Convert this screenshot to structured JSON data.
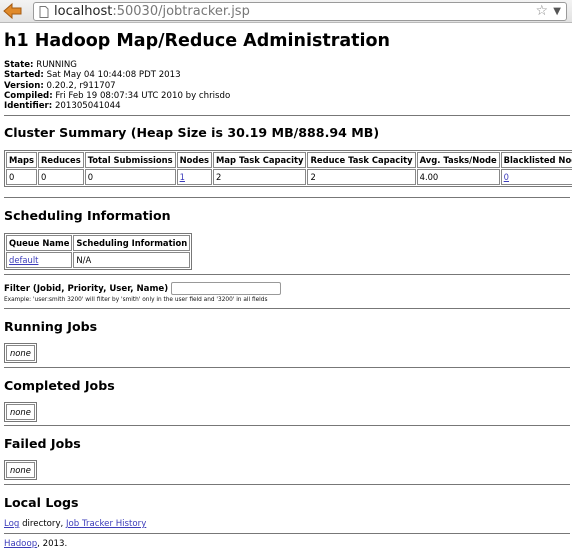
{
  "browser": {
    "url_host": "localhost",
    "url_path": ":50030/jobtracker.jsp"
  },
  "page": {
    "title": "h1 Hadoop Map/Reduce Administration",
    "info": [
      {
        "label": "State:",
        "value": "RUNNING"
      },
      {
        "label": "Started:",
        "value": "Sat May 04 10:44:08 PDT 2013"
      },
      {
        "label": "Version:",
        "value": "0.20.2, r911707"
      },
      {
        "label": "Compiled:",
        "value": "Fri Feb 19 08:07:34 UTC 2010 by chrisdo"
      },
      {
        "label": "Identifier:",
        "value": "201305041044"
      }
    ]
  },
  "cluster": {
    "heading": "Cluster Summary (Heap Size is 30.19 MB/888.94 MB)",
    "headers": [
      "Maps",
      "Reduces",
      "Total Submissions",
      "Nodes",
      "Map Task Capacity",
      "Reduce Task Capacity",
      "Avg. Tasks/Node",
      "Blacklisted Nodes"
    ],
    "values": [
      "0",
      "0",
      "0",
      "1",
      "2",
      "2",
      "4.00",
      "0"
    ]
  },
  "scheduling": {
    "heading": "Scheduling Information",
    "headers": [
      "Queue Name",
      "Scheduling Information"
    ],
    "queue": "default",
    "info": "N/A"
  },
  "filter": {
    "label": "Filter (Jobid, Priority, User, Name)",
    "example": "Example: 'user:smith 3200' will filter by 'smith' only in the user field and '3200' in all fields"
  },
  "running": {
    "heading": "Running Jobs",
    "empty": "none"
  },
  "completed": {
    "heading": "Completed Jobs",
    "empty": "none"
  },
  "failed": {
    "heading": "Failed Jobs",
    "empty": "none"
  },
  "logs": {
    "heading": "Local Logs",
    "log_link": "Log",
    "directory_text": " directory, ",
    "history_link": "Job Tracker History"
  },
  "footer": {
    "link": "Hadoop",
    "suffix": ", 2013."
  }
}
